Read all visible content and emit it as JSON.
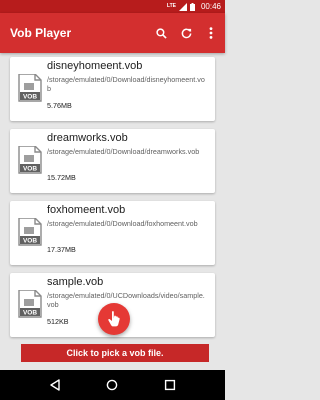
{
  "status_bar": {
    "network": "LTE",
    "time": "00:46"
  },
  "toolbar": {
    "title": "Vob Player",
    "icons": [
      "search-icon",
      "refresh-icon",
      "more-vert-icon"
    ]
  },
  "files": [
    {
      "name": "disneyhomeent.vob",
      "path": "/storage/emulated/0/Download/disneyhomeent.vob",
      "size": "5.76MB",
      "icon_label": "VOB"
    },
    {
      "name": "dreamworks.vob",
      "path": "/storage/emulated/0/Download/dreamworks.vob",
      "size": "15.72MB",
      "icon_label": "VOB"
    },
    {
      "name": "foxhomeent.vob",
      "path": "/storage/emulated/0/Download/foxhomeent.vob",
      "size": "17.37MB",
      "icon_label": "VOB"
    },
    {
      "name": "sample.vob",
      "path": "/storage/emulated/0/UCDownloads/video/sample.vob",
      "size": "512KB",
      "icon_label": "VOB"
    }
  ],
  "hint": "Click to pick a vob file.",
  "colors": {
    "primary": "#d32f2f",
    "status": "#b71c1c",
    "fab": "#e53935",
    "hint": "#c62828"
  }
}
